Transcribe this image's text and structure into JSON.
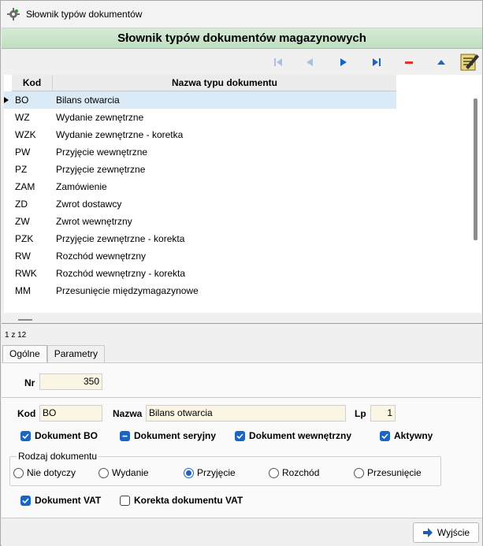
{
  "window": {
    "title": "Słownik typów dokumentów",
    "icon": "app-gear-icon"
  },
  "header": {
    "title": "Słownik typów dokumentów magazynowych"
  },
  "navigator": {
    "buttons": [
      {
        "name": "first-record-icon"
      },
      {
        "name": "prior-record-icon"
      },
      {
        "name": "next-record-icon"
      },
      {
        "name": "last-record-icon"
      },
      {
        "name": "delete-record-icon"
      },
      {
        "name": "post-record-icon"
      }
    ]
  },
  "grid": {
    "columns": [
      "Kod",
      "Nazwa typu dokumentu"
    ],
    "rows": [
      {
        "kod": "BO",
        "nazwa": "Bilans otwarcia"
      },
      {
        "kod": "WZ",
        "nazwa": "Wydanie zewnętrzne"
      },
      {
        "kod": "WZK",
        "nazwa": "Wydanie zewnętrzne - koretka"
      },
      {
        "kod": "PW",
        "nazwa": "Przyjęcie wewnętrzne"
      },
      {
        "kod": "PZ",
        "nazwa": "Przyjęcie zewnętrzne"
      },
      {
        "kod": "ZAM",
        "nazwa": "Zamówienie"
      },
      {
        "kod": "ZD",
        "nazwa": "Zwrot dostawcy"
      },
      {
        "kod": "ZW",
        "nazwa": "Zwrot wewnętrzny"
      },
      {
        "kod": "PZK",
        "nazwa": "Przyjęcie zewnętrzne - korekta"
      },
      {
        "kod": "RW",
        "nazwa": "Rozchód wewnętrzny"
      },
      {
        "kod": "RWK",
        "nazwa": "Rozchód wewnętrzny - korekta"
      },
      {
        "kod": "MM",
        "nazwa": "Przesunięcie międzymagazynowe"
      }
    ],
    "selected_index": 0
  },
  "counter": "1 z 12",
  "tabs": [
    {
      "label": "Ogólne"
    },
    {
      "label": "Parametry"
    }
  ],
  "form": {
    "nr_label": "Nr",
    "nr_value": "350",
    "kod_label": "Kod",
    "kod_value": "BO",
    "nazwa_label": "Nazwa",
    "nazwa_value": "Bilans otwarcia",
    "lp_label": "Lp",
    "lp_value": "1",
    "checks": {
      "dokument_bo": "Dokument BO",
      "dokument_seryjny": "Dokument seryjny",
      "dokument_wewnetrzny": "Dokument wewnętrzny",
      "aktywny": "Aktywny",
      "dokument_vat": "Dokument VAT",
      "korekta_vat": "Korekta dokumentu VAT"
    },
    "rodzaj": {
      "title": "Rodzaj dokumentu",
      "options": [
        "Nie dotyczy",
        "Wydanie",
        "Przyjęcie",
        "Rozchód",
        "Przesunięcie"
      ],
      "selected": "Przyjęcie"
    }
  },
  "footer": {
    "exit_label": "Wyjście"
  },
  "colors": {
    "header_green": "#c8e6c8",
    "accent_blue": "#1b63c4",
    "selection": "#dbeaf7"
  }
}
